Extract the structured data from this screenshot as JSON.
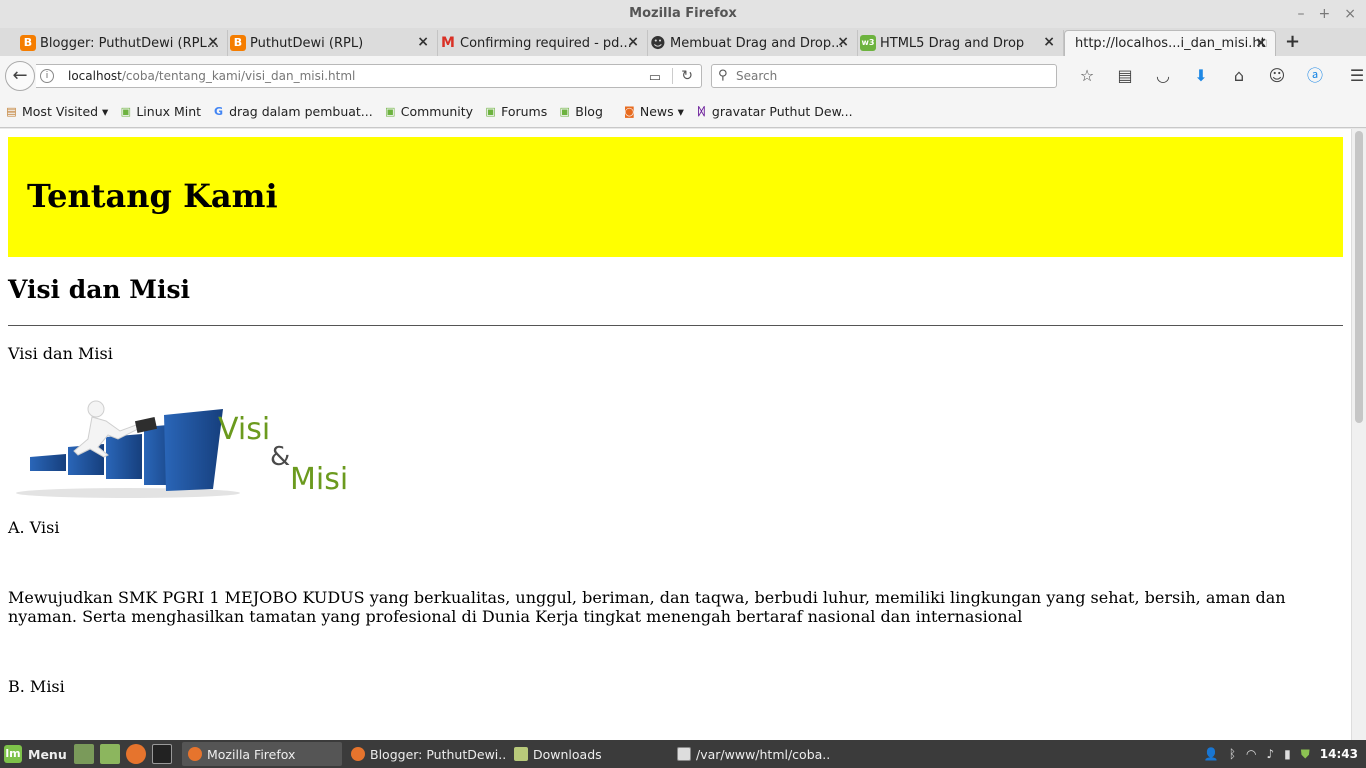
{
  "window": {
    "title": "Mozilla Firefox",
    "controls": [
      "–",
      "+",
      "×"
    ]
  },
  "tabs": [
    {
      "label": "Blogger: PuthutDewi (RPL...",
      "icon_color": "#f57d00",
      "icon": "B"
    },
    {
      "label": "PuthutDewi (RPL)",
      "icon_color": "#f57d00",
      "icon": "B"
    },
    {
      "label": "Confirming required - pd...",
      "icon_color": "#d93025",
      "icon": "M"
    },
    {
      "label": "Membuat Drag and Drop...",
      "icon_color": "#333333",
      "icon": "☻"
    },
    {
      "label": "HTML5 Drag and Drop",
      "icon_color": "#6db33f",
      "icon": "w3"
    },
    {
      "label": "http://localhos...i_dan_misi.html",
      "icon_color": "",
      "icon": ""
    }
  ],
  "tab_close": "×",
  "new_tab": "+",
  "nav": {
    "back": "←",
    "url_host": "localhost",
    "url_path": "/coba/tentang_kami/visi_dan_misi.html",
    "search_placeholder": "Search"
  },
  "bookmarks": [
    {
      "label": "Most Visited ▾",
      "icon": "▤",
      "color": "#c07a2a"
    },
    {
      "label": "Linux Mint",
      "icon": "▣",
      "color": "#6db33f"
    },
    {
      "label": "drag dalam pembuat...",
      "icon": "G",
      "color": "#4285f4"
    },
    {
      "label": "Community",
      "icon": "▣",
      "color": "#6db33f"
    },
    {
      "label": "Forums",
      "icon": "▣",
      "color": "#6db33f"
    },
    {
      "label": "Blog",
      "icon": "▣",
      "color": "#6db33f"
    },
    {
      "label": "News ▾",
      "icon": "◙",
      "color": "#e86b1f"
    },
    {
      "label": "gravatar Puthut Dew...",
      "icon": "ᛞ",
      "color": "#6a1b9a"
    }
  ],
  "page": {
    "banner_title": "Tentang Kami",
    "heading": "Visi dan Misi",
    "intro": "Visi dan Misi",
    "image_word_1": "Visi",
    "image_word_2": "&",
    "image_word_3": "Misi",
    "section_a": "A. Visi",
    "visi_text": "Mewujudkan SMK PGRI 1 MEJOBO KUDUS yang berkualitas, unggul, beriman, dan taqwa, berbudi luhur, memiliki lingkungan yang sehat, bersih, aman dan nyaman. Serta menghasilkan tamatan yang profesional di Dunia Kerja tingkat menengah bertaraf nasional dan internasional",
    "section_b": "B. Misi",
    "banner_color": "#ffff00"
  },
  "taskbar": {
    "menu_label": "Menu",
    "tasks": [
      "Mozilla Firefox",
      "Blogger: PuthutDewi...",
      "Downloads",
      "/var/www/html/coba..."
    ],
    "clock": "14:43"
  }
}
